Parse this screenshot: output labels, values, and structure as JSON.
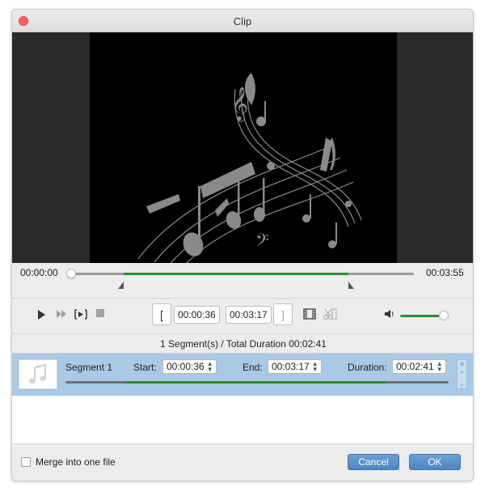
{
  "window": {
    "title": "Clip"
  },
  "timeline": {
    "start_time": "00:00:00",
    "end_time": "00:03:55",
    "playhead_fraction": 0.0,
    "selection_start_fraction": 0.153,
    "selection_end_fraction": 0.81
  },
  "controls": {
    "play_icon": "play-icon",
    "fast_forward_icon": "fast-forward-icon",
    "frame_step_icon": "frame-step-icon",
    "stop_icon": "stop-icon",
    "set_start_label": "[",
    "start_time": "00:00:36",
    "end_time": "00:03:17",
    "set_end_label": "]",
    "add_segment_icon": "film-add-icon",
    "split_icon": "scissors-film-icon",
    "volume_icon": "speaker-icon",
    "volume_fraction": 0.9
  },
  "summary": {
    "text": "1 Segment(s) / Total Duration 00:02:41"
  },
  "segments": [
    {
      "name": "Segment 1",
      "start_label": "Start:",
      "start": "00:00:36",
      "end_label": "End:",
      "end": "00:03:17",
      "duration_label": "Duration:",
      "duration": "00:02:41",
      "thumb_icon": "music-note-icon",
      "range_start_fraction": 0.153,
      "range_end_fraction": 0.838
    }
  ],
  "footer": {
    "merge_label": "Merge into one file",
    "merge_checked": false,
    "cancel_label": "Cancel",
    "ok_label": "OK"
  },
  "colors": {
    "accent_green": "#2e8b2e",
    "button_blue": "#5a92ca",
    "selection_blue": "#a9c9e6"
  }
}
